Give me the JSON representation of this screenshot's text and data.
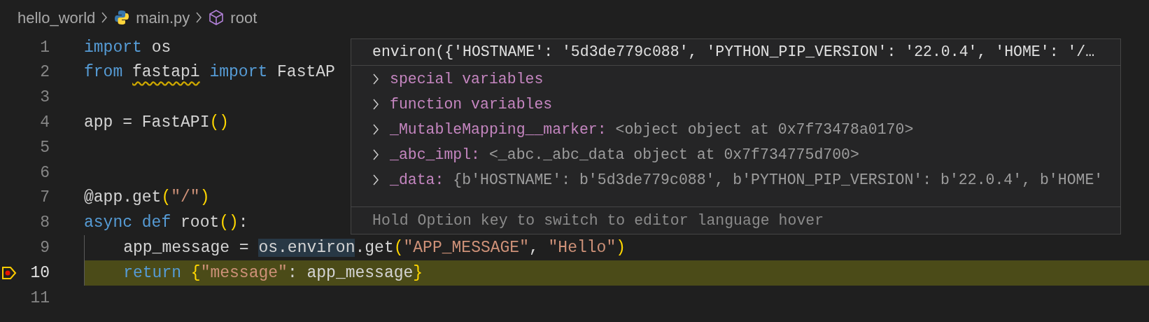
{
  "breadcrumb": [
    {
      "label": "hello_world",
      "kind": "folder"
    },
    {
      "label": "main.py",
      "kind": "python"
    },
    {
      "label": "root",
      "kind": "symbol"
    }
  ],
  "editor": {
    "lines": [
      {
        "number": "1",
        "current": false,
        "breakpoint": false,
        "tokens": [
          {
            "text": "import",
            "kind": "keyword"
          },
          {
            "text": " os",
            "kind": "plain"
          }
        ]
      },
      {
        "number": "2",
        "current": false,
        "breakpoint": false,
        "tokens": [
          {
            "text": "from ",
            "kind": "keyword"
          },
          {
            "text": "fastapi",
            "kind": "plain",
            "squiggle": true
          },
          {
            "text": " import",
            "kind": "keyword"
          },
          {
            "text": " FastAP",
            "kind": "plain"
          }
        ]
      },
      {
        "number": "3",
        "current": false,
        "breakpoint": false
      },
      {
        "number": "4",
        "current": false,
        "breakpoint": false,
        "tokens": [
          {
            "text": "app = FastAPI",
            "kind": "plain"
          },
          {
            "text": "()",
            "kind": "bracket"
          }
        ]
      },
      {
        "number": "5",
        "current": false,
        "breakpoint": false
      },
      {
        "number": "6",
        "current": false,
        "breakpoint": false
      },
      {
        "number": "7",
        "current": false,
        "breakpoint": false,
        "tokens": [
          {
            "text": "@app.get",
            "kind": "plain"
          },
          {
            "text": "(",
            "kind": "bracket"
          },
          {
            "text": "\"/\"",
            "kind": "string"
          },
          {
            "text": ")",
            "kind": "bracket"
          }
        ]
      },
      {
        "number": "8",
        "current": false,
        "breakpoint": false,
        "tokens": [
          {
            "text": "async def",
            "kind": "keyword"
          },
          {
            "text": " root",
            "kind": "plain"
          },
          {
            "text": "()",
            "kind": "bracket"
          },
          {
            "text": ":",
            "kind": "plain"
          }
        ]
      },
      {
        "number": "9",
        "current": false,
        "breakpoint": false,
        "tokens": [
          {
            "text": "    app_message = ",
            "kind": "plain"
          },
          {
            "text": "os.environ",
            "kind": "plain",
            "highlight": true
          },
          {
            "text": ".get",
            "kind": "plain"
          },
          {
            "text": "(",
            "kind": "bracket"
          },
          {
            "text": "\"APP_MESSAGE\"",
            "kind": "string"
          },
          {
            "text": ", ",
            "kind": "plain"
          },
          {
            "text": "\"Hello\"",
            "kind": "string"
          },
          {
            "text": ")",
            "kind": "bracket"
          }
        ]
      },
      {
        "number": "10",
        "current": true,
        "breakpoint": true,
        "tokens": [
          {
            "text": "    return",
            "kind": "keyword"
          },
          {
            "text": " {",
            "kind": "bracket"
          },
          {
            "text": "\"message\"",
            "kind": "string"
          },
          {
            "text": ": app_message",
            "kind": "plain"
          },
          {
            "text": "}",
            "kind": "bracket"
          }
        ]
      },
      {
        "number": "11",
        "current": false,
        "breakpoint": false
      }
    ]
  },
  "hover": {
    "title": "environ({'HOSTNAME': '5d3de779c088', 'PYTHON_PIP_VERSION': '22.0.4', 'HOME': '/…",
    "items": [
      {
        "label": "special variables"
      },
      {
        "label": "function variables"
      },
      {
        "label": "_MutableMapping__marker:",
        "value": "<object object at 0x7f73478a0170>"
      },
      {
        "label": "_abc_impl:",
        "value": "<_abc._abc_data object at 0x7f734775d700>"
      },
      {
        "label": "_data:",
        "value": "{b'HOSTNAME': b'5d3de779c088', b'PYTHON_PIP_VERSION': b'22.0.4', b'HOME'"
      }
    ],
    "hint": "Hold Option key to switch to editor language hover"
  }
}
